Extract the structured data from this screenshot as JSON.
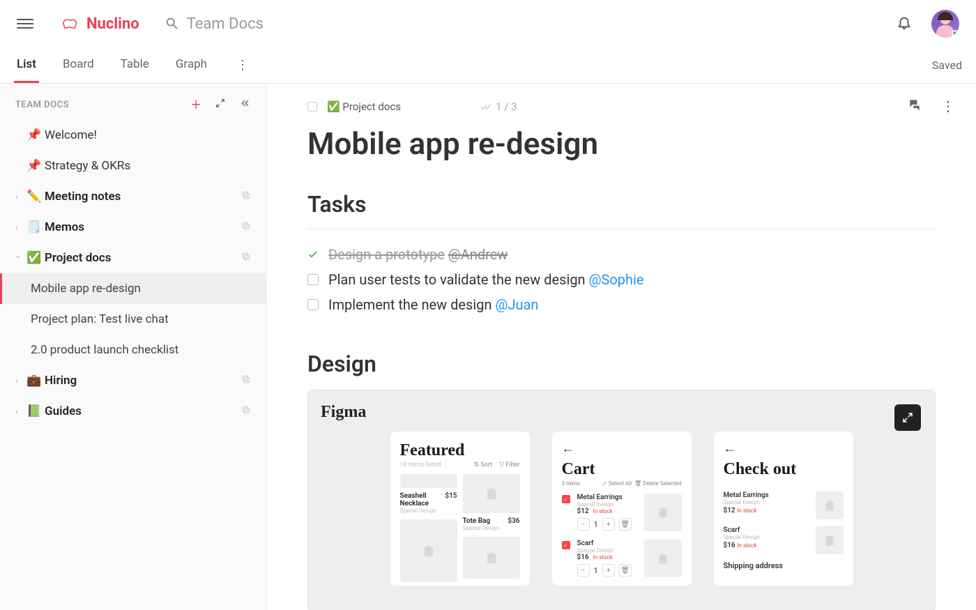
{
  "app": {
    "name": "Nuclino",
    "search_placeholder": "Team Docs"
  },
  "tabs": {
    "items": [
      "List",
      "Board",
      "Table",
      "Graph"
    ],
    "active": 0,
    "saved_label": "Saved"
  },
  "sidebar": {
    "title": "TEAM DOCS",
    "items": [
      {
        "label": "Welcome!",
        "icon": "📌",
        "pinned": true
      },
      {
        "label": "Strategy & OKRs",
        "icon": "📌",
        "pinned": true
      },
      {
        "label": "Meeting notes",
        "icon": "✏️",
        "collapsible": true,
        "bold": true,
        "clone": true
      },
      {
        "label": "Memos",
        "icon": "🗒️",
        "collapsible": true,
        "bold": true,
        "clone": true
      },
      {
        "label": "Project docs",
        "icon": "✅",
        "collapsible": true,
        "expanded": true,
        "bold": true,
        "clone": true,
        "children": [
          {
            "label": "Mobile app re-design",
            "active": true
          },
          {
            "label": "Project plan: Test live chat"
          },
          {
            "label": "2.0 product launch checklist"
          }
        ]
      },
      {
        "label": "Hiring",
        "icon": "💼",
        "collapsible": true,
        "bold": true,
        "clone": true
      },
      {
        "label": "Guides",
        "icon": "📗",
        "collapsible": true,
        "bold": true,
        "clone": true
      }
    ]
  },
  "doc": {
    "breadcrumb_icon": "✅",
    "breadcrumb_label": "Project docs",
    "progress": "1 / 3",
    "title": "Mobile app re-design",
    "sections": {
      "tasks": {
        "heading": "Tasks",
        "items": [
          {
            "text": "Design a prototype",
            "mention": "@Andrew",
            "done": true
          },
          {
            "text": "Plan user tests to validate the new design",
            "mention": "@Sophie",
            "done": false
          },
          {
            "text": "Implement the new design",
            "mention": "@Juan",
            "done": false
          }
        ]
      },
      "design": {
        "heading": "Design",
        "embed": {
          "tool": "Figma",
          "screens": {
            "featured": {
              "title": "Featured",
              "sub": "18 items listed",
              "sort": "Sort",
              "filter": "Filter",
              "items": [
                {
                  "name": "Seashell Necklace",
                  "sub": "Special Design",
                  "price": "$15"
                },
                {
                  "name": "Tote Bag",
                  "sub": "Special Design",
                  "price": "$36"
                }
              ]
            },
            "cart": {
              "title": "Cart",
              "count": "3 items",
              "select_all": "Select All",
              "delete": "Delete Selected",
              "items": [
                {
                  "name": "Metal Earrings",
                  "sub": "Special Design",
                  "price": "$12",
                  "stock": "In stock",
                  "qty": "1"
                },
                {
                  "name": "Scarf",
                  "sub": "Special Design",
                  "price": "$16",
                  "stock": "In stock",
                  "qty": "1"
                }
              ]
            },
            "checkout": {
              "title": "Check out",
              "items": [
                {
                  "name": "Metal Earrings",
                  "sub": "Special Design",
                  "price": "$12",
                  "stock": "In stock"
                },
                {
                  "name": "Scarf",
                  "sub": "Special Design",
                  "price": "$16",
                  "stock": "In stock"
                }
              ],
              "shipping_label": "Shipping address"
            }
          }
        }
      }
    }
  }
}
